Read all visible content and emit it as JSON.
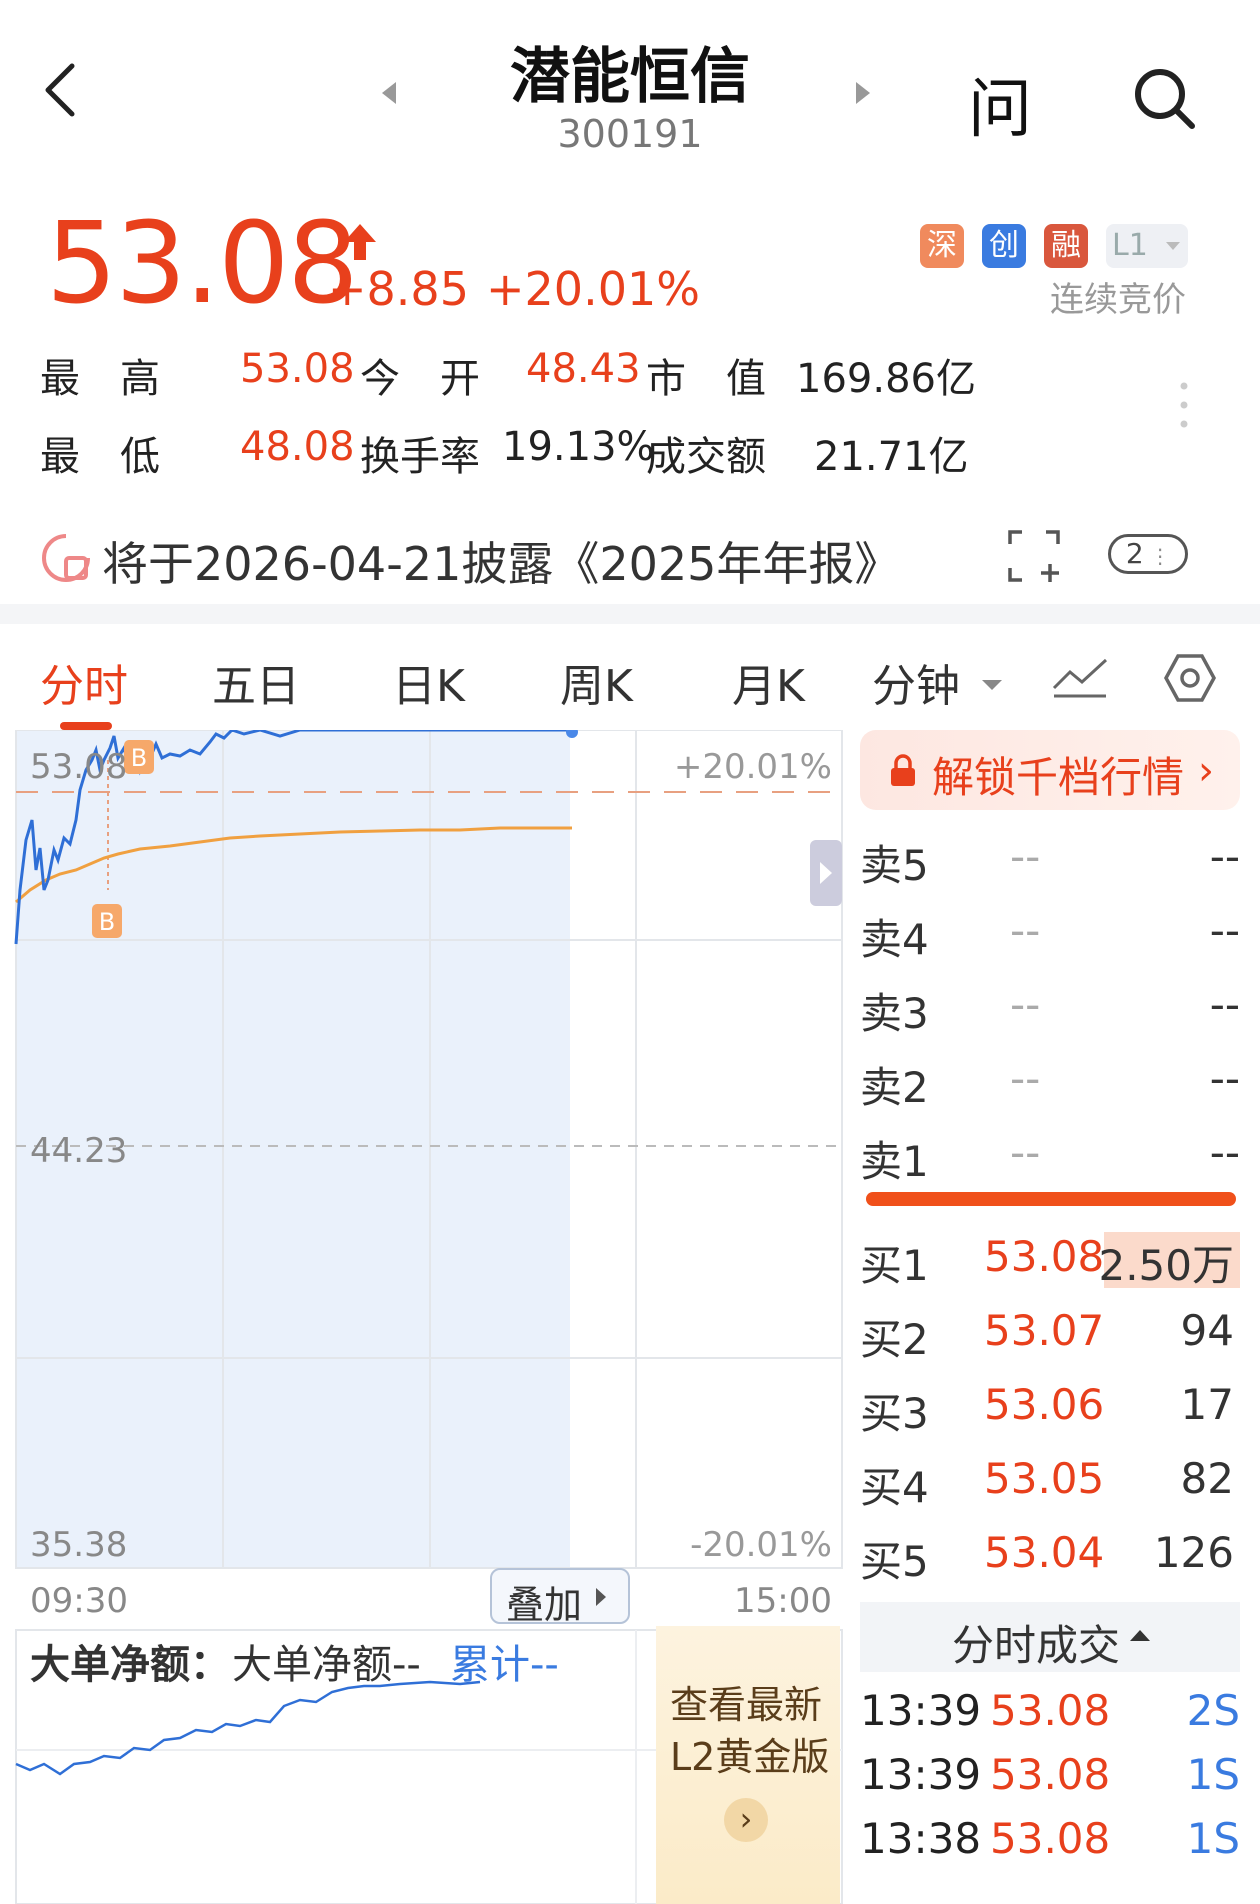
{
  "header": {
    "name": "潜能恒信",
    "code": "300191",
    "ask_label": "问"
  },
  "quote": {
    "price": "53.08",
    "change": "+8.85",
    "change_pct": "+20.01%",
    "tags": {
      "shen": "深",
      "chuang": "创",
      "rong": "融",
      "level": "L1"
    },
    "auction": "连续竞价"
  },
  "stats": {
    "high_label": "最　高",
    "high": "53.08",
    "open_label": "今　开",
    "open": "48.43",
    "mcap_label": "市　值",
    "mcap": "169.86亿",
    "low_label": "最　低",
    "low": "48.08",
    "turnover_label": "换手率",
    "turnover": "19.13%",
    "amount_label": "成交额",
    "amount": "21.71亿"
  },
  "notice": {
    "text": "将于2026-04-21披露《2025年年报》",
    "count": "2"
  },
  "tabs": [
    "分时",
    "五日",
    "日K",
    "周K",
    "月K",
    "分钟"
  ],
  "chart": {
    "y_top": "53.08",
    "y_mid": "44.23",
    "y_bottom": "35.38",
    "pct_top": "+20.01%",
    "pct_bottom": "-20.01%",
    "time_start": "09:30",
    "time_end": "15:00",
    "marker_label": "B",
    "overlay": "叠加",
    "big_order_label": "大单净额：",
    "big_order_text": "大单净额--",
    "big_order_cum": "累计--",
    "colors": {
      "price": "#2f6fd6",
      "avg": "#f0a040",
      "accent": "#e8401c"
    }
  },
  "orderbook": {
    "unlock": "解锁千档行情",
    "asks": [
      {
        "label": "卖5",
        "price": "--",
        "vol": "--"
      },
      {
        "label": "卖4",
        "price": "--",
        "vol": "--"
      },
      {
        "label": "卖3",
        "price": "--",
        "vol": "--"
      },
      {
        "label": "卖2",
        "price": "--",
        "vol": "--"
      },
      {
        "label": "卖1",
        "price": "--",
        "vol": "--"
      }
    ],
    "bids": [
      {
        "label": "买1",
        "price": "53.08",
        "vol": "2.50万"
      },
      {
        "label": "买2",
        "price": "53.07",
        "vol": "94"
      },
      {
        "label": "买3",
        "price": "53.06",
        "vol": "17"
      },
      {
        "label": "买4",
        "price": "53.05",
        "vol": "82"
      },
      {
        "label": "买5",
        "price": "53.04",
        "vol": "126"
      }
    ]
  },
  "trades": {
    "title": "分时成交",
    "rows": [
      {
        "time": "13:39",
        "price": "53.08",
        "vol": "2S"
      },
      {
        "time": "13:39",
        "price": "53.08",
        "vol": "1S"
      },
      {
        "time": "13:38",
        "price": "53.08",
        "vol": "1S"
      }
    ]
  },
  "promo": {
    "line1": "查看最新",
    "line2": "L2黄金版"
  }
}
